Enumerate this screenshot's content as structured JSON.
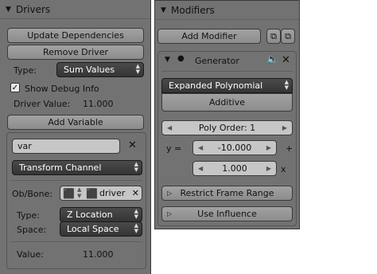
{
  "drivers": {
    "title": "Drivers",
    "update_deps": "Update Dependencies",
    "remove_driver": "Remove Driver",
    "type_label": "Type:",
    "type_value": "Sum Values",
    "show_debug": "Show Debug Info",
    "show_debug_checked": true,
    "driver_value_label": "Driver Value:",
    "driver_value": "11.000",
    "add_variable": "Add Variable",
    "variable": {
      "name": "var",
      "channel": "Transform Channel",
      "obbone_label": "Ob/Bone:",
      "object": "driver",
      "type_label": "Type:",
      "type_value": "Z Location",
      "space_label": "Space:",
      "space_value": "Local Space",
      "value_label": "Value:",
      "value": "11.000"
    }
  },
  "modifiers": {
    "title": "Modifiers",
    "add_modifier": "Add Modifier",
    "generator": {
      "name": "Generator",
      "mode": "Expanded Polynomial",
      "additive": "Additive",
      "poly_order": "Poly Order: 1",
      "y_eq": "y =",
      "coef0": "-10.000",
      "plus": "+",
      "coef1": "1.000",
      "x": "x"
    },
    "restrict_frame_range": "Restrict Frame Range",
    "use_influence": "Use Influence"
  }
}
